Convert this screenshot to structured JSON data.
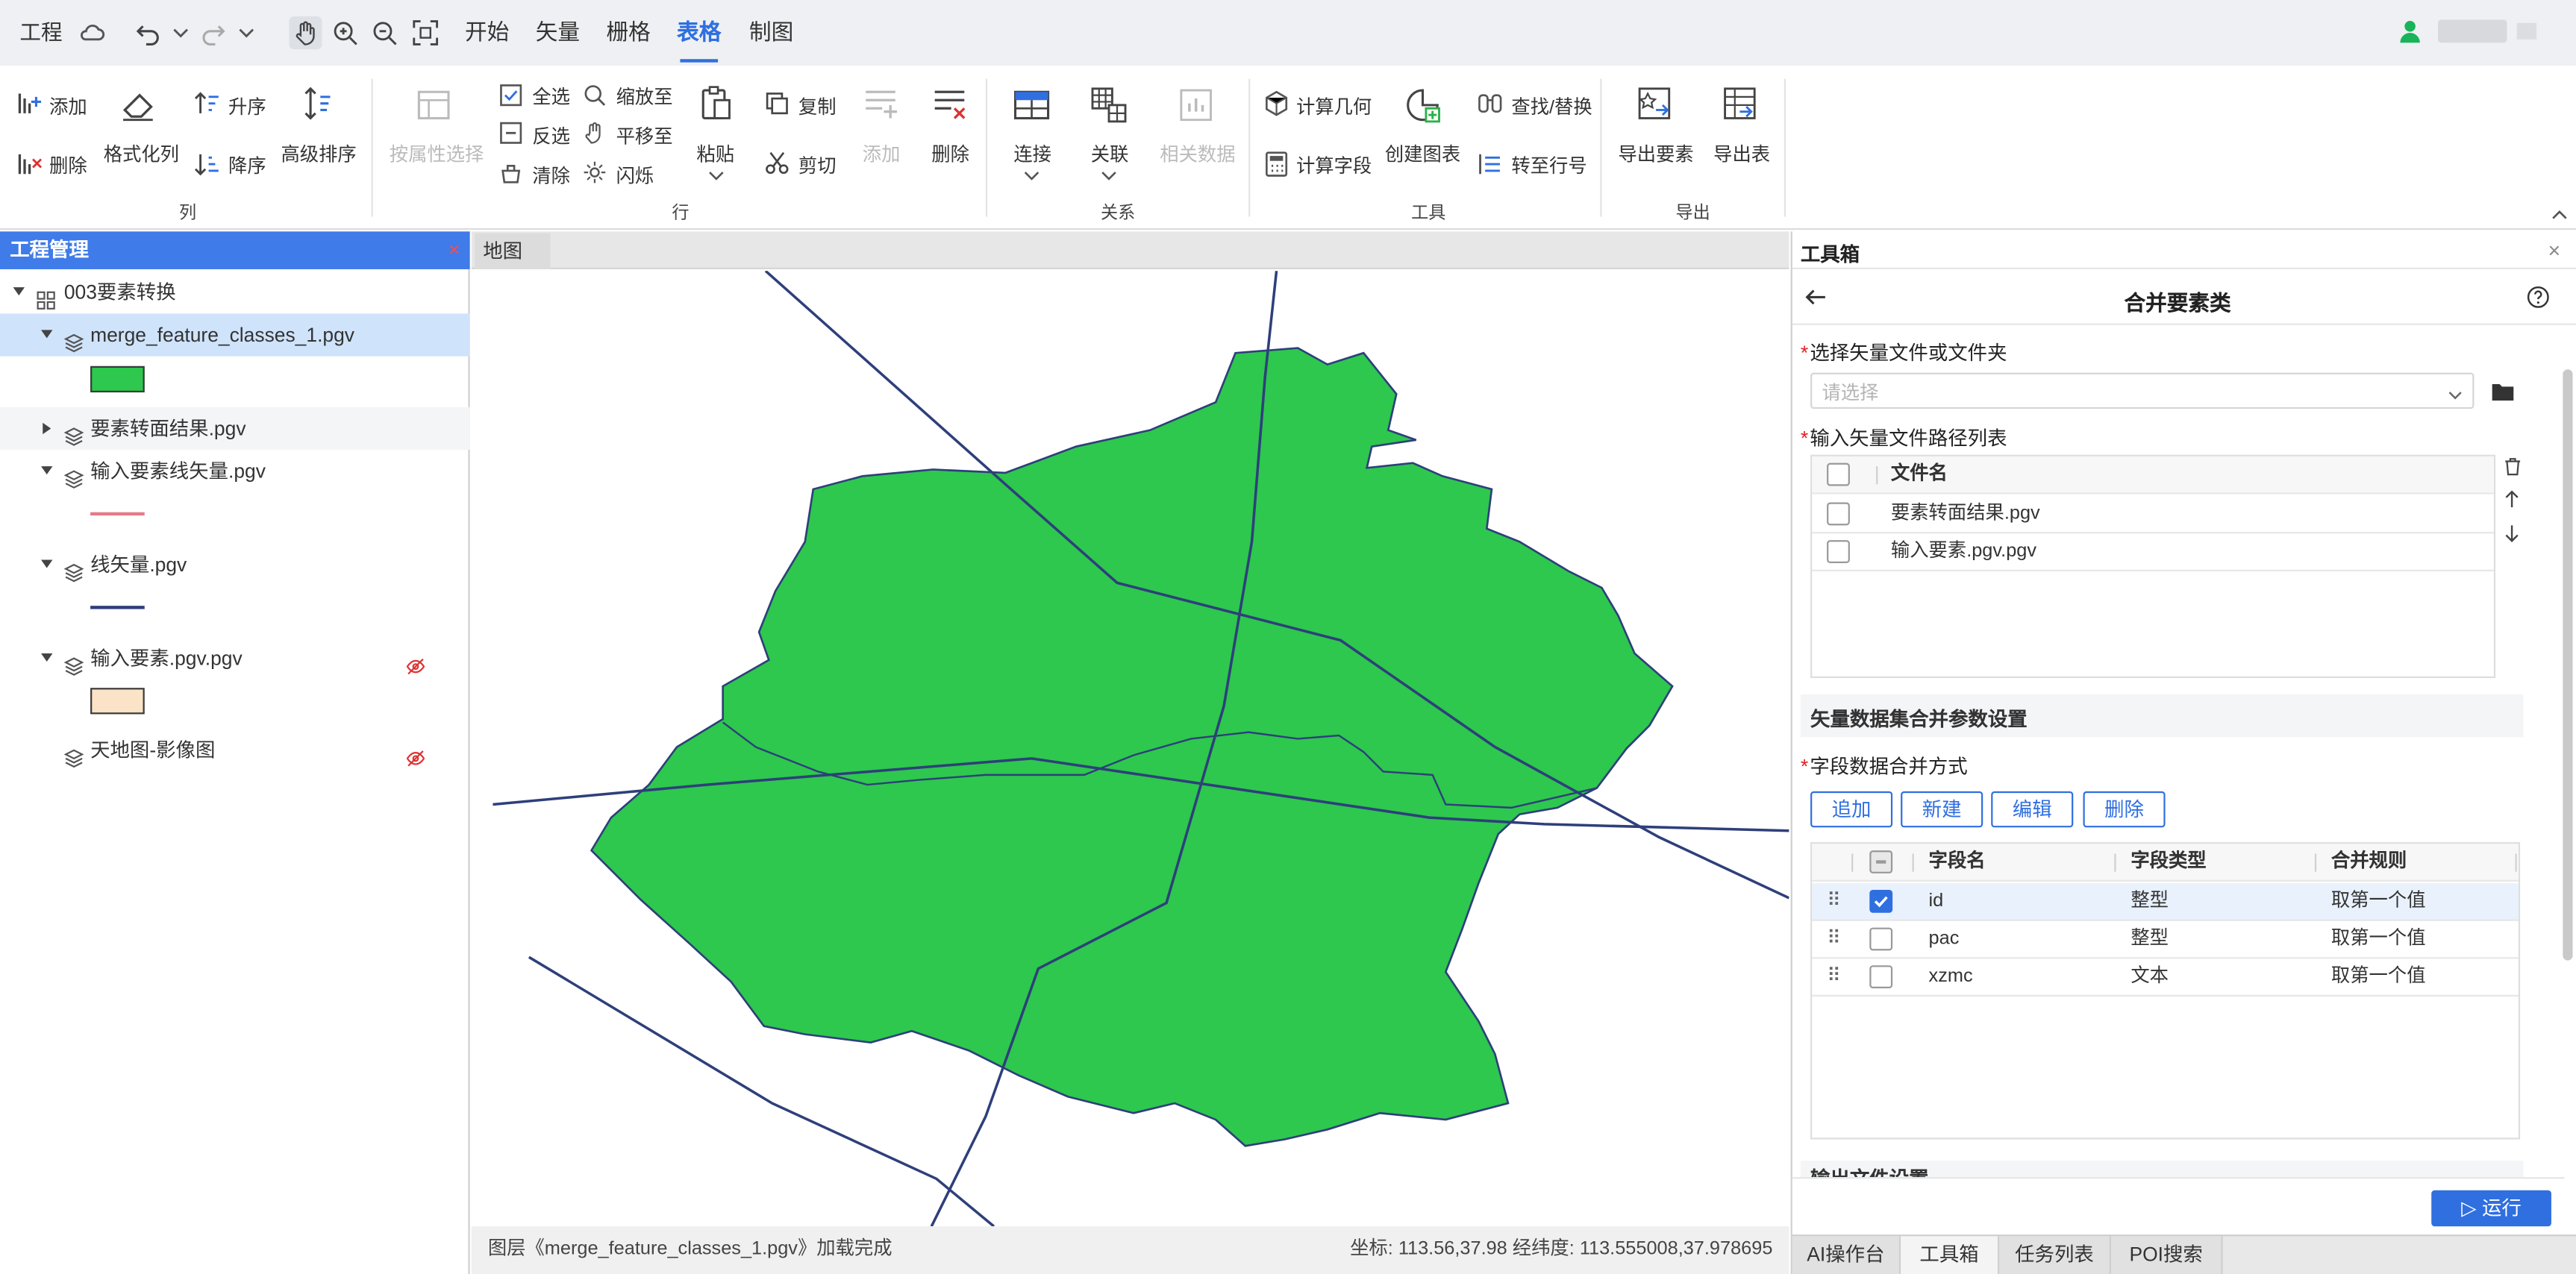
{
  "topbar": {
    "project_label": "工程",
    "tabs": [
      {
        "label": "开始",
        "active": false
      },
      {
        "label": "矢量",
        "active": false
      },
      {
        "label": "栅格",
        "active": false
      },
      {
        "label": "表格",
        "active": true
      },
      {
        "label": "制图",
        "active": false
      }
    ],
    "accent_color": "#2f6fe0"
  },
  "ribbon": {
    "column_group": {
      "label": "列",
      "add": "添加",
      "delete": "删除",
      "format": "格式化列",
      "asc": "升序",
      "desc": "降序",
      "advanced_sort": "高级排序"
    },
    "row_group": {
      "label": "行",
      "select_by_attr": "按属性选择",
      "select_all": "全选",
      "invert": "反选",
      "clear": "清除",
      "zoom_to": "缩放至",
      "pan_to": "平移至",
      "flash": "闪烁",
      "paste": "粘贴",
      "copy": "复制",
      "cut": "剪切",
      "add": "添加",
      "delete": "删除"
    },
    "relation_group": {
      "label": "关系",
      "join": "连接",
      "relate": "关联",
      "related_data": "相关数据"
    },
    "tools_group": {
      "label": "工具",
      "calc_geometry": "计算几何",
      "calc_field": "计算字段",
      "create_chart": "创建图表",
      "find_replace": "查找/替换",
      "to_row": "转至行号"
    },
    "export_group": {
      "label": "导出",
      "export_features": "导出要素",
      "export_table": "导出表"
    }
  },
  "left_panel": {
    "title": "工程管理",
    "project": "003要素转换",
    "layers": [
      {
        "name": "merge_feature_classes_1.pgv",
        "selected": true,
        "swatch": "#2dc84d"
      },
      {
        "name": "要素转面结果.pgv"
      },
      {
        "name": "输入要素线矢量.pgv",
        "swatch_line": "#e57a8a"
      },
      {
        "name": "线矢量.pgv",
        "swatch_line": "#2e3f7a"
      },
      {
        "name": "输入要素.pgv.pgv",
        "hidden": true,
        "swatch": "#fbe3c8"
      },
      {
        "name": "天地图-影像图",
        "hidden": true
      }
    ]
  },
  "map": {
    "tab": "地图",
    "fill_color": "#2dc84d",
    "line_color": "#2e3f7a",
    "status_left": "图层《merge_feature_classes_1.pgv》加载完成",
    "status_right": "坐标: 113.56,37.98 经纬度: 113.555008,37.978695"
  },
  "toolbox": {
    "title": "工具箱",
    "tool_title": "合并要素类",
    "select_label": "选择矢量文件或文件夹",
    "select_placeholder": "请选择",
    "input_list_label": "输入矢量文件路径列表",
    "file_header": "文件名",
    "files": [
      "要素转面结果.pgv",
      "输入要素.pgv.pgv"
    ],
    "settings_section": "矢量数据集合并参数设置",
    "merge_method_label": "字段数据合并方式",
    "buttons": [
      "追加",
      "新建",
      "编辑",
      "删除"
    ],
    "field_headers": [
      "字段名",
      "字段类型",
      "合并规则"
    ],
    "fields": [
      {
        "name": "id",
        "type": "整型",
        "rule": "取第一个值",
        "checked": true
      },
      {
        "name": "pac",
        "type": "整型",
        "rule": "取第一个值",
        "checked": false
      },
      {
        "name": "xzmc",
        "type": "文本",
        "rule": "取第一个值",
        "checked": false
      }
    ],
    "output_section": "输出文件设置",
    "run_label": "▷ 运行"
  },
  "bottom_tabs": [
    {
      "label": "AI操作台",
      "active": false
    },
    {
      "label": "工具箱",
      "active": true
    },
    {
      "label": "任务列表",
      "active": false
    },
    {
      "label": "POI搜索",
      "active": false
    }
  ]
}
